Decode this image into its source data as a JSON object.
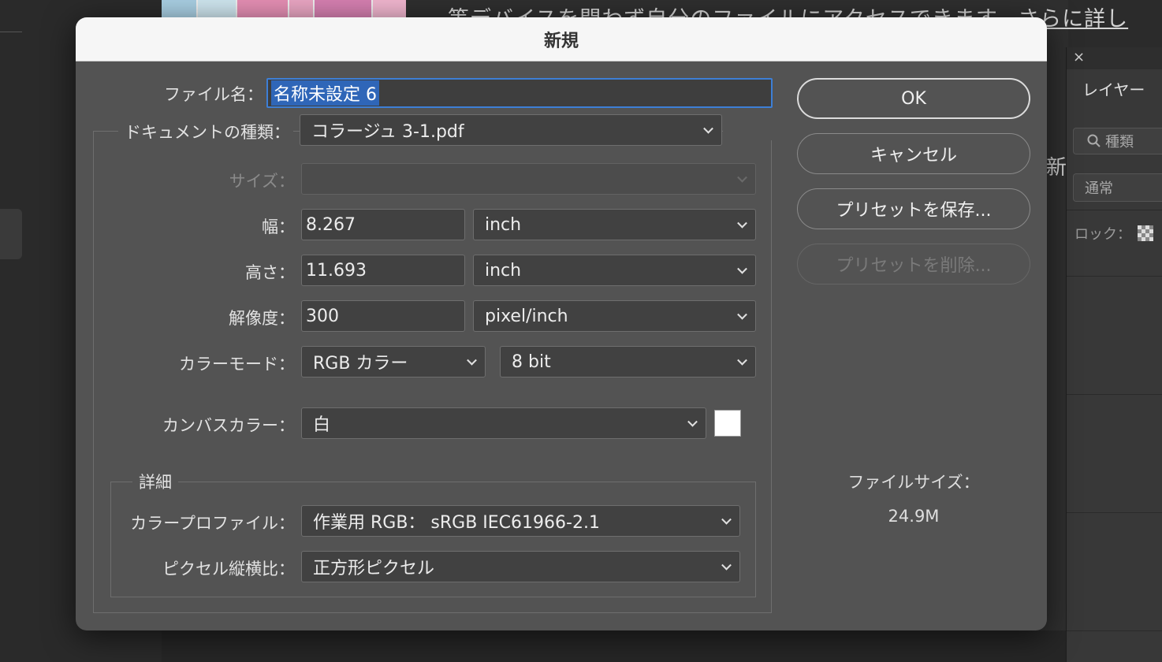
{
  "background": {
    "doc_text_main": "等デバイスを問わず自分のファイルにアクセスできます。",
    "doc_text_link": "さらに詳し",
    "doc_text_side": "新"
  },
  "layers_panel": {
    "close": "×",
    "title": "レイヤー",
    "search_placeholder": "種類",
    "blend_mode": "通常",
    "lock_label": "ロック："
  },
  "dialog": {
    "title": "新規",
    "filename_label": "ファイル名：",
    "filename_value": "名称未設定 6",
    "doc_type_label": "ドキュメントの種類：",
    "doc_type_value": "コラージュ 3-1.pdf",
    "size_label": "サイズ：",
    "size_value": "",
    "width_label": "幅：",
    "width_value": "8.267",
    "width_unit": "inch",
    "height_label": "高さ：",
    "height_value": "11.693",
    "height_unit": "inch",
    "resolution_label": "解像度：",
    "resolution_value": "300",
    "resolution_unit": "pixel/inch",
    "color_mode_label": "カラーモード：",
    "color_mode_value": "RGB カラー",
    "bit_depth_value": "8 bit",
    "canvas_color_label": "カンバスカラー：",
    "canvas_color_value": "白",
    "canvas_color_swatch": "#ffffff",
    "advanced_label": "詳細",
    "color_profile_label": "カラープロファイル：",
    "color_profile_value": "作業用 RGB： sRGB IEC61966-2.1",
    "pixel_aspect_label": "ピクセル縦横比：",
    "pixel_aspect_value": "正方形ピクセル",
    "ok_label": "OK",
    "cancel_label": "キャンセル",
    "save_preset_label": "プリセットを保存...",
    "delete_preset_label": "プリセットを削除...",
    "file_size_label": "ファイルサイズ：",
    "file_size_value": "24.9M"
  },
  "colors": {
    "dialog_bg": "#535353",
    "field_bg": "#414141",
    "focus_ring": "#3d7fd6",
    "selection": "#2f66b8"
  }
}
